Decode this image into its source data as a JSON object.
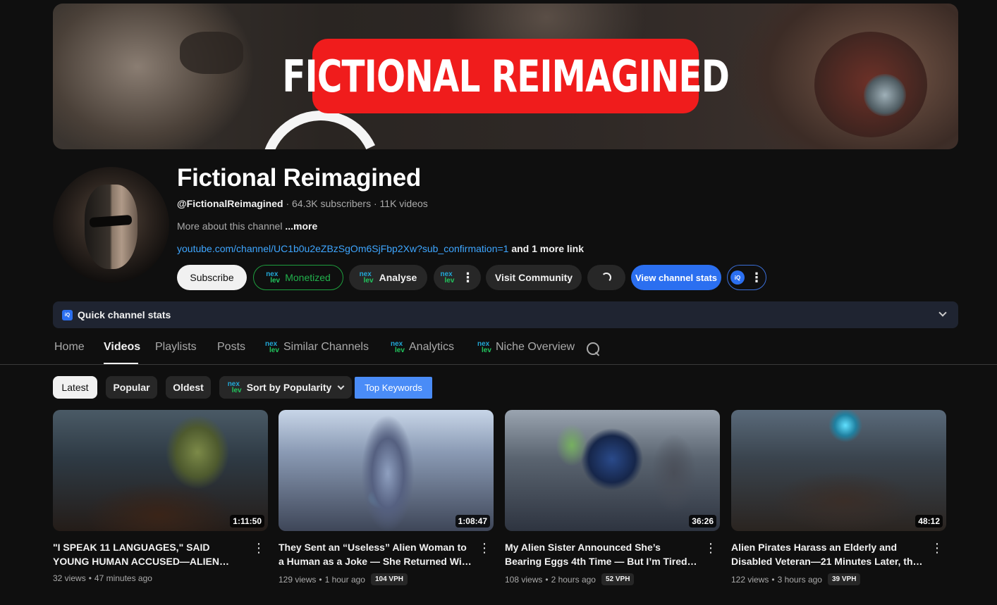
{
  "banner": {
    "title": "FICTIONAL REIMAGINED"
  },
  "channel": {
    "name": "Fictional Reimagined",
    "handle": "@FictionalReimagined",
    "subscribers": "64.3K subscribers",
    "videos": "11K videos",
    "about_text": "More about this channel",
    "about_more": "...more",
    "link": "youtube.com/channel/UC1b0u2eZBzSgOm6SjFbp2Xw?sub_confirmation=1",
    "link_more": "and 1 more link"
  },
  "actions": {
    "subscribe": "Subscribe",
    "monetized": "Monetized",
    "analyse": "Analyse",
    "visit_community": "Visit Community",
    "view_stats": "View channel stats"
  },
  "quick_stats": {
    "label": "Quick channel stats",
    "badge": "iQ"
  },
  "tabs": {
    "home": "Home",
    "videos": "Videos",
    "playlists": "Playlists",
    "posts": "Posts",
    "similar": "Similar Channels",
    "analytics": "Analytics",
    "niche": "Niche Overview"
  },
  "filters": {
    "latest": "Latest",
    "popular": "Popular",
    "oldest": "Oldest",
    "sort": "Sort by Popularity",
    "keywords": "Top Keywords"
  },
  "videos": [
    {
      "title": "\"I SPEAK 11 LANGUAGES,\" SAID YOUNG HUMAN ACCUSED—ALIEN JUDGE FROZE IN SHOCK",
      "duration": "1:11:50",
      "views": "32 views",
      "age": "47 minutes ago",
      "vph": ""
    },
    {
      "title": "They Sent an “Useless” Alien Woman to a Human as a Joke — She Returned With Twins",
      "duration": "1:08:47",
      "views": "129 views",
      "age": "1 hour ago",
      "vph": "104 VPH"
    },
    {
      "title": "My Alien Sister Announced She’s Bearing Eggs 4th Time — But I’m Tired Of Raising Her Kids",
      "duration": "36:26",
      "views": "108 views",
      "age": "2 hours ago",
      "vph": "52 VPH"
    },
    {
      "title": "Alien Pirates Harass an Elderly and Disabled Veteran—21 Minutes Later, the EMPEROR'S FLEET ARRIVES",
      "duration": "48:12",
      "views": "122 views",
      "age": "3 hours ago",
      "vph": "39 VPH"
    }
  ],
  "meta_separator": "•",
  "nexlev_icon": {
    "top": "nex",
    "bottom": "lev"
  }
}
